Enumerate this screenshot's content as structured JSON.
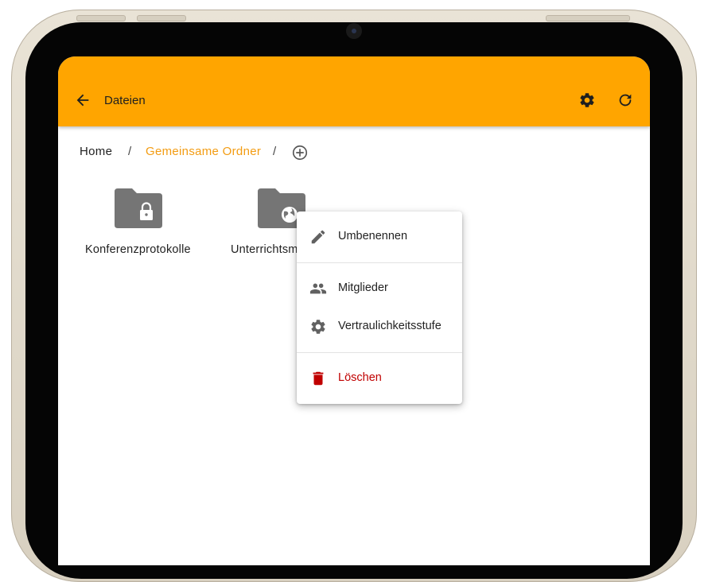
{
  "appbar": {
    "title": "Dateien",
    "background_color": "#ffa500",
    "icons": [
      "arrow-left-icon",
      "gear-icon",
      "refresh-icon"
    ]
  },
  "breadcrumb": {
    "home": "Home",
    "separator": "/",
    "current": "Gemeinsame Ordner",
    "current_color": "#f39c12",
    "add_icon": "plus-circle-icon"
  },
  "folders": [
    {
      "name": "Konferenzprotokolle",
      "badge_icon": "lock-icon"
    },
    {
      "name": "Unterrichtsm",
      "badge_icon": "globe-icon"
    }
  ],
  "context_menu": {
    "items": [
      {
        "label": "Umbenennen",
        "icon": "pencil-icon"
      },
      {
        "label": "Mitglieder",
        "icon": "people-icon"
      },
      {
        "label": "Vertraulichkeitsstufe",
        "icon": "gear-icon"
      },
      {
        "label": "Löschen",
        "icon": "trash-icon",
        "color": "#c00000"
      }
    ]
  }
}
